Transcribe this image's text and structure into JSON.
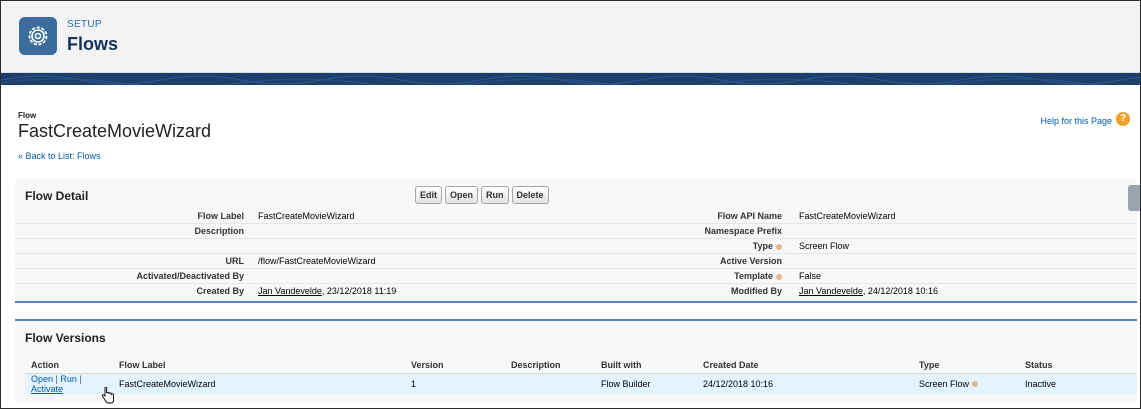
{
  "header": {
    "kicker": "SETUP",
    "title": "Flows",
    "icon": "gear-icon"
  },
  "page": {
    "kicker": "Flow",
    "title": "FastCreateMovieWizard",
    "help_link": "Help for this Page",
    "back_link": "« Back to List: Flows"
  },
  "detail": {
    "title": "Flow Detail",
    "buttons": {
      "edit": "Edit",
      "open": "Open",
      "run": "Run",
      "delete": "Delete"
    },
    "left": [
      {
        "label": "Flow Label",
        "value": "FastCreateMovieWizard"
      },
      {
        "label": "Description",
        "value": ""
      },
      {
        "label": "",
        "value": ""
      },
      {
        "label": "URL",
        "value": "/flow/FastCreateMovieWizard"
      },
      {
        "label": "Activated/Deactivated By",
        "value": ""
      },
      {
        "label": "Created By",
        "user": "Jan Vandevelde",
        "value": ", 23/12/2018 11:19"
      }
    ],
    "right": [
      {
        "label": "Flow API Name",
        "value": "FastCreateMovieWizard"
      },
      {
        "label": "Namespace Prefix",
        "value": ""
      },
      {
        "label": "Type",
        "value": "Screen Flow"
      },
      {
        "label": "Active Version",
        "value": ""
      },
      {
        "label": "Template",
        "value": "False"
      },
      {
        "label": "Modified By",
        "user": "Jan Vandevelde",
        "value": ", 24/12/2018 10:16"
      }
    ]
  },
  "versions": {
    "title": "Flow Versions",
    "columns": [
      "Action",
      "Flow Label",
      "Version",
      "Description",
      "Built with",
      "Created Date",
      "Type",
      "Status"
    ],
    "rows": [
      {
        "actions": {
          "open": "Open",
          "run": "Run",
          "activate": "Activate",
          "sep": "|"
        },
        "flow_label": "FastCreateMovieWizard",
        "version": "1",
        "description": "",
        "built_with": "Flow Builder",
        "created_date": "24/12/2018 10:16",
        "type": "Screen Flow",
        "status": "Inactive"
      }
    ]
  },
  "colors": {
    "accent": "#5486b6",
    "link": "#015ba7",
    "banner": "#1d3f6e",
    "row_highlight": "#e3f3ff"
  }
}
